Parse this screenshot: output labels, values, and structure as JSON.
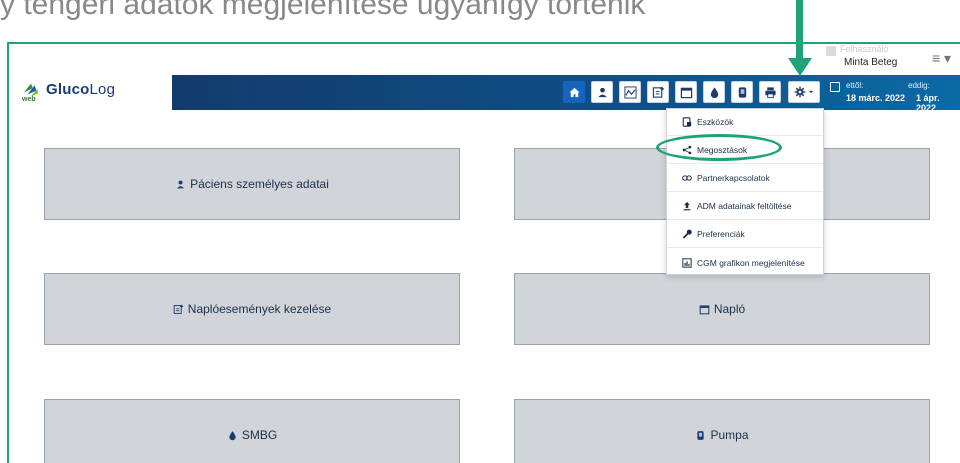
{
  "caption": "ý tengeri adatok megjelenítése ugyanígy történik",
  "app": {
    "logo_primary": "Gluco",
    "logo_secondary": "Log",
    "logo_sub": "web"
  },
  "toolbar": {
    "buttons": [
      {
        "name": "home",
        "icon": "home-icon"
      },
      {
        "name": "patient",
        "icon": "person-icon"
      },
      {
        "name": "glucose-chart",
        "icon": "chart-line-icon"
      },
      {
        "name": "log-events",
        "icon": "notebook-edit-icon"
      },
      {
        "name": "calendar",
        "icon": "calendar-icon"
      },
      {
        "name": "smbg",
        "icon": "drop-icon"
      },
      {
        "name": "pump",
        "icon": "pump-icon"
      },
      {
        "name": "print",
        "icon": "printer-icon"
      },
      {
        "name": "settings",
        "icon": "gear-icon"
      }
    ]
  },
  "patient": {
    "ghost_label": "Felhasználó",
    "name": "Minta Beteg"
  },
  "date_range": {
    "from_label": "ettől:",
    "to_label": "eddig:",
    "from": "18 márc. 2022",
    "to": "1 ápr. 2022"
  },
  "settings_menu": {
    "items": [
      {
        "label": "Eszközök",
        "icon": "device-icon"
      },
      {
        "label": "Megosztások",
        "icon": "share-icon",
        "highlighted": true
      },
      {
        "label": "Partnerkapcsolatok",
        "icon": "link-icon"
      },
      {
        "label": "ADM adatainak feltöltése",
        "icon": "upload-icon"
      },
      {
        "label": "Preferenciák",
        "icon": "wrench-icon"
      },
      {
        "label": "CGM grafikon megjelenítése",
        "icon": "chart-bar-icon"
      }
    ]
  },
  "cards": [
    {
      "label": "Páciens személyes adatai",
      "icon": "person-icon"
    },
    {
      "label": "",
      "icon": ""
    },
    {
      "label": "Naplóesemények kezelése",
      "icon": "notebook-edit-icon"
    },
    {
      "label": "Napló",
      "icon": "calendar-icon"
    },
    {
      "label": "SMBG",
      "icon": "drop-icon"
    },
    {
      "label": "Pumpa",
      "icon": "pump-icon"
    }
  ],
  "colors": {
    "accent": "#1fa27a",
    "navbar_start": "#123b6c",
    "navbar_end": "#0b6aa6",
    "card_bg": "#d1d5da",
    "active_button": "#1565c0"
  }
}
